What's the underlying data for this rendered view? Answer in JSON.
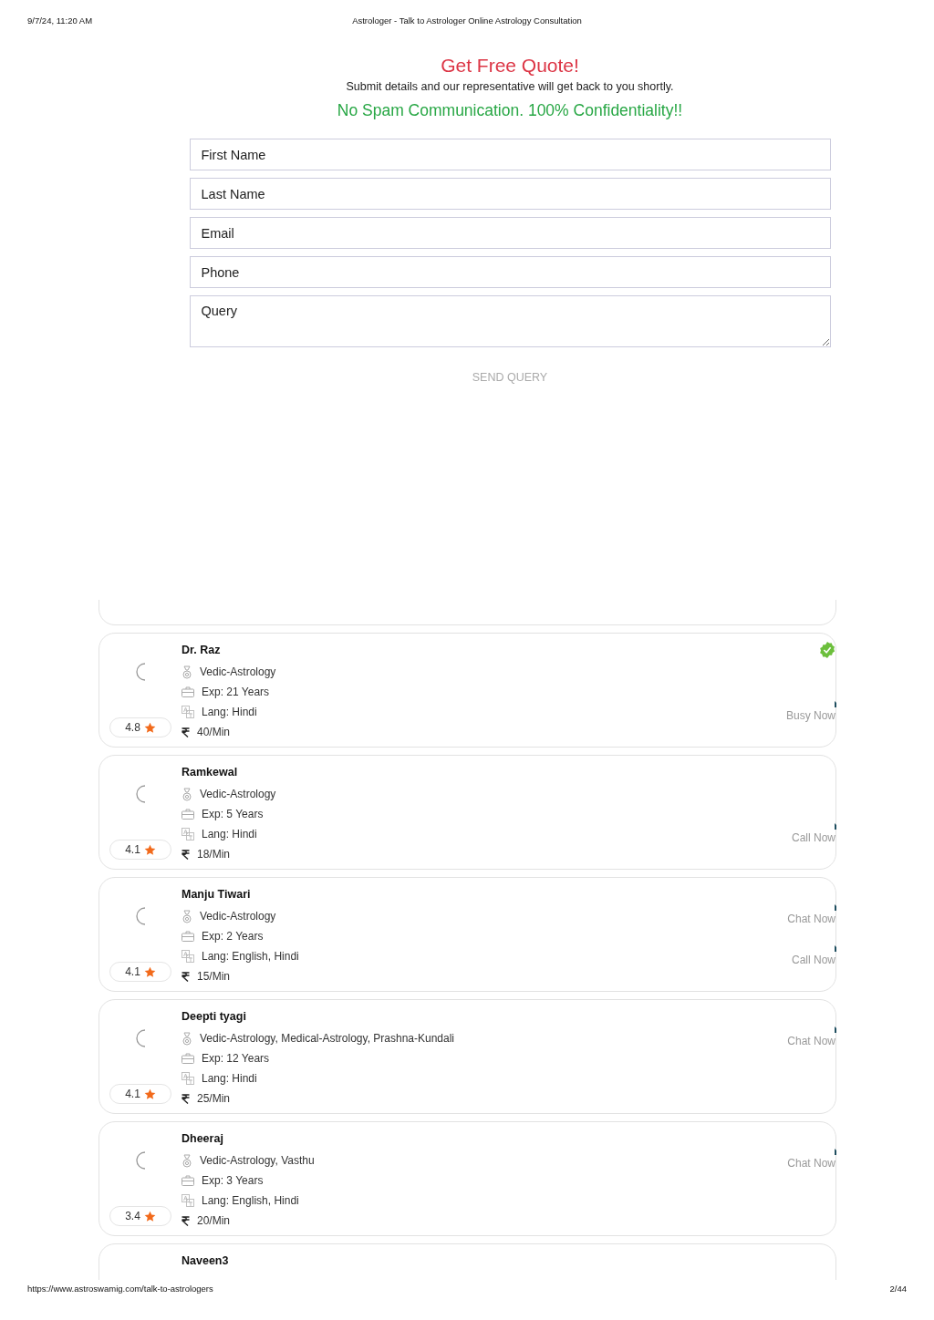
{
  "print_header": {
    "date": "9/7/24, 11:20 AM",
    "title": "Astrologer - Talk to Astrologer Online Astrology Consultation"
  },
  "quote_form": {
    "title": "Get Free Quote!",
    "subtitle": "Submit details and our representative will get back to you shortly.",
    "tagline": "No Spam Communication. 100% Confidentiality!!",
    "fields": [
      {
        "kind": "input",
        "placeholder": "First Name"
      },
      {
        "kind": "input",
        "placeholder": "Last Name"
      },
      {
        "kind": "input",
        "placeholder": "Email"
      },
      {
        "kind": "input",
        "placeholder": "Phone"
      },
      {
        "kind": "textarea",
        "placeholder": "Query"
      }
    ],
    "submit": "SEND QUERY"
  },
  "astrologers": [
    {
      "name": "Dr. Raz",
      "verified": true,
      "rating": "4.8",
      "skills": "Vedic-Astrology",
      "experience": "Exp: 21 Years",
      "languages": "Lang: Hindi",
      "price": "40/Min",
      "actions": [
        {
          "kind": "busy",
          "label": "Busy Now"
        }
      ]
    },
    {
      "name": "Ramkewal",
      "verified": false,
      "rating": "4.1",
      "skills": "Vedic-Astrology",
      "experience": "Exp: 5 Years",
      "languages": "Lang: Hindi",
      "price": "18/Min",
      "actions": [
        {
          "kind": "call",
          "label": "Call Now"
        }
      ]
    },
    {
      "name": "Manju Tiwari",
      "verified": false,
      "rating": "4.1",
      "skills": "Vedic-Astrology",
      "experience": "Exp: 2 Years",
      "languages": "Lang: English, Hindi",
      "price": "15/Min",
      "actions": [
        {
          "kind": "chat",
          "label": "Chat Now"
        },
        {
          "kind": "call",
          "label": "Call Now"
        }
      ]
    },
    {
      "name": "Deepti tyagi",
      "verified": false,
      "rating": "4.1",
      "skills": "Vedic-Astrology, Medical-Astrology, Prashna-Kundali",
      "experience": "Exp: 12 Years",
      "languages": "Lang: Hindi",
      "price": "25/Min",
      "actions": [
        {
          "kind": "chat",
          "label": "Chat Now"
        }
      ]
    },
    {
      "name": "Dheeraj",
      "verified": false,
      "rating": "3.4",
      "skills": "Vedic-Astrology, Vasthu",
      "experience": "Exp: 3 Years",
      "languages": "Lang: English, Hindi",
      "price": "20/Min",
      "actions": [
        {
          "kind": "chat",
          "label": "Chat Now"
        }
      ]
    },
    {
      "name": "Naveen3"
    }
  ],
  "print_footer": {
    "url": "https://www.astroswamig.com/talk-to-astrologers",
    "page": "2/44"
  }
}
